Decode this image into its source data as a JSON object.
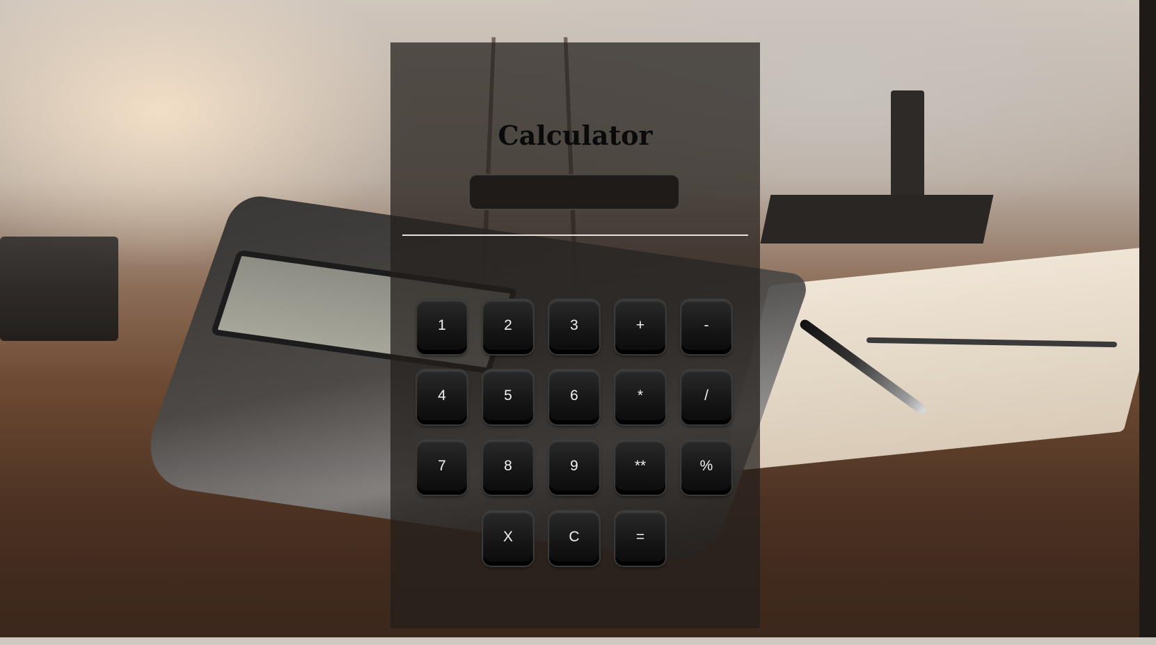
{
  "app": {
    "title": "Calculator"
  },
  "display": {
    "value": "",
    "placeholder": ""
  },
  "keypad": {
    "row1": [
      "1",
      "2",
      "3",
      "+",
      "-"
    ],
    "row2": [
      "4",
      "5",
      "6",
      "*",
      "/"
    ],
    "row3": [
      "7",
      "8",
      "9",
      "**",
      "%"
    ],
    "row4": [
      "X",
      "C",
      "="
    ]
  },
  "colors": {
    "panel": "#221e1c",
    "key": "#141414",
    "key_text": "#f2f2f2",
    "title": "#0a0a0a",
    "divider": "#e6e1dc"
  }
}
